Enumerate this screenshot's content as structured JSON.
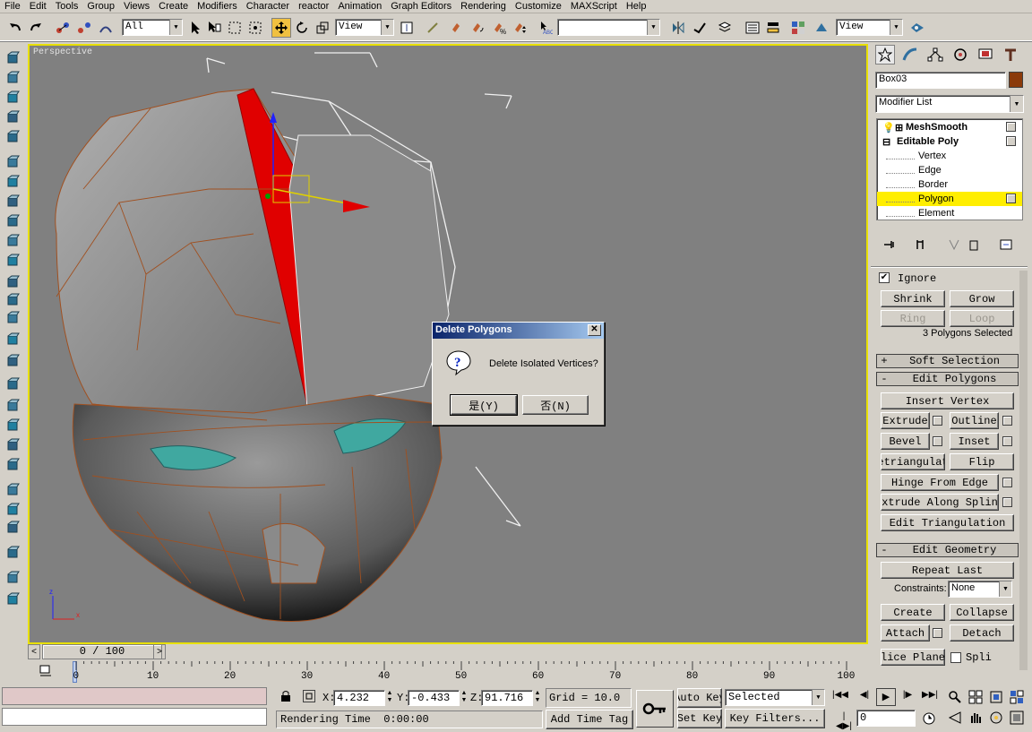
{
  "menu": [
    "File",
    "Edit",
    "Tools",
    "Group",
    "Views",
    "Create",
    "Modifiers",
    "Character",
    "reactor",
    "Animation",
    "Graph Editors",
    "Rendering",
    "Customize",
    "MAXScript",
    "Help"
  ],
  "toolbar": {
    "filter": "All",
    "ref_coord": "View",
    "named_sel": "",
    "view2": "View"
  },
  "viewport": {
    "label": "Perspective"
  },
  "dialog": {
    "title": "Delete Polygons",
    "message": "Delete Isolated Vertices?",
    "yes": "是(Y)",
    "no": "否(N)",
    "icon": "question-icon"
  },
  "panel": {
    "object_name": "Box03",
    "object_color": "#8b3a0a",
    "modifier_list": "Modifier List",
    "stack": [
      "MeshSmooth",
      "Editable Poly",
      "Vertex",
      "Edge",
      "Border",
      "Polygon",
      "Element"
    ],
    "ignore": "Ignore",
    "shrink": "Shrink",
    "grow": "Grow",
    "ring": "Ring",
    "loop": "Loop",
    "selected_count": "3 Polygons Selected",
    "soft_selection": "Soft Selection",
    "edit_polygons": "Edit Polygons",
    "insert_vertex": "Insert Vertex",
    "extrude": "Extrude",
    "outline": "Outline",
    "bevel": "Bevel",
    "inset": "Inset",
    "retriangulate": "etriangulat",
    "flip": "Flip",
    "hinge": "Hinge From Edge",
    "extrude_spline": "xtrude Along Splin",
    "edit_tri": "Edit Triangulation",
    "edit_geometry": "Edit Geometry",
    "repeat_last": "Repeat Last",
    "constraints": "Constraints:",
    "constraints_val": "None",
    "create": "Create",
    "collapse": "Collapse",
    "attach": "Attach",
    "detach": "Detach",
    "slice_plane": "lice Plane",
    "split": "Spli"
  },
  "trackbar": {
    "frame": "0 / 100"
  },
  "ruler": [
    "0",
    "10",
    "20",
    "30",
    "40",
    "50",
    "60",
    "70",
    "80",
    "90",
    "100"
  ],
  "status": {
    "x_label": "X:",
    "x": "4.232",
    "y_label": "Y:",
    "y": "-0.433",
    "z_label": "Z:",
    "z": "91.716",
    "grid": "Grid = 10.0",
    "auto_key": "Auto Key",
    "set_key": "Set Key",
    "selected": "Selected",
    "key_filters": "Key Filters...",
    "rendering_time_label": "Rendering Time",
    "rendering_time": "0:00:00",
    "add_time_tag": "Add Time Tag",
    "frame_field": "0"
  }
}
